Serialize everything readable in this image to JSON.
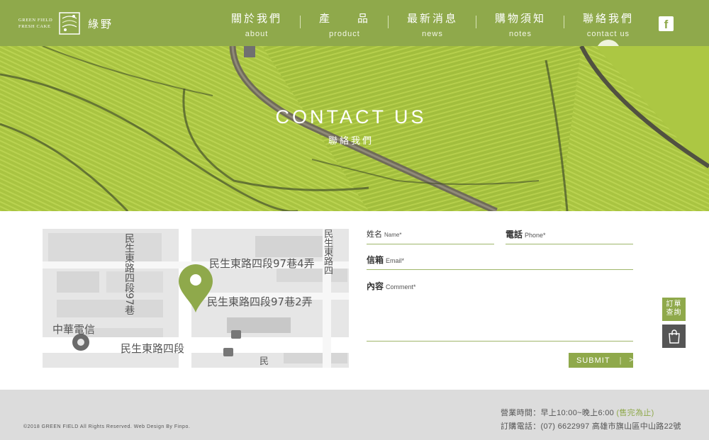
{
  "brand": {
    "logo_line1": "GREEN FIELD",
    "logo_line2": "FRESH CAKE",
    "logo_cn": "綠野"
  },
  "nav": [
    {
      "cn": "關於我們",
      "en": "about"
    },
    {
      "cn": "產　　品",
      "en": "product"
    },
    {
      "cn": "最新消息",
      "en": "news"
    },
    {
      "cn": "購物須知",
      "en": "notes"
    },
    {
      "cn": "聯絡我們",
      "en": "contact us",
      "active": true
    }
  ],
  "social": {
    "facebook_glyph": "f"
  },
  "hero": {
    "title": "CONTACT US",
    "subtitle": "聯絡我們"
  },
  "map": {
    "labels": {
      "lane4": "民生東路四段97巷4弄",
      "lane2": "民生東路四段97巷2弄",
      "main_road": "民生東路四段",
      "lane97": "民生東路四段97巷",
      "telecom": "中華電信",
      "top_right": "民生東路四",
      "bottom_right": "民"
    }
  },
  "form": {
    "name": {
      "cn": "姓名",
      "en": "Name*"
    },
    "phone": {
      "cn": "電話",
      "en": "Phone*"
    },
    "email": {
      "cn": "信箱",
      "en": "Email*"
    },
    "comment": {
      "cn": "內容",
      "en": "Comment*"
    },
    "submit": "SUBMIT",
    "submit_bar": "|",
    "submit_chev": ">"
  },
  "side": {
    "order_line1": "訂單",
    "order_line2": "查詢"
  },
  "footer": {
    "copyright": "©2018 GREEN FIELD All Rights Reserved. Web Design By Finpo.",
    "hours_label": "營業時間：早上10:00~晚上6:00 ",
    "hours_note": "(售完為止)",
    "phone": "訂購電話：(07) 6622997  高雄市旗山區中山路22號"
  },
  "colors": {
    "brand_green": "#8fa94b",
    "footer_bg": "#dcdcdc",
    "cart_bg": "#555555"
  }
}
